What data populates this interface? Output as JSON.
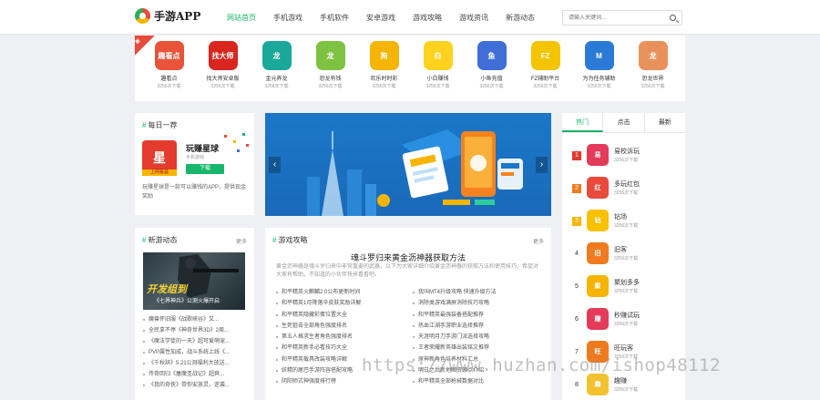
{
  "header": {
    "logo_text": "手游APP",
    "nav": [
      "网站首页",
      "手机游戏",
      "手机软件",
      "安卓游戏",
      "游戏攻略",
      "游戏资讯",
      "新游动态"
    ],
    "search_placeholder": "请输入关键词..."
  },
  "new_badge": "新",
  "apps": [
    {
      "name": "趣看点",
      "downloads": "3256次下载",
      "icon_text": "趣看点",
      "color": "#e8533a"
    },
    {
      "name": "找大师安卓版",
      "downloads": "3256次下载",
      "icon_text": "找大师",
      "color": "#d9251d"
    },
    {
      "name": "金元养龙",
      "downloads": "3256次下载",
      "icon_text": "龙",
      "color": "#1aa89a"
    },
    {
      "name": "恐龙有钱",
      "downloads": "3256次下载",
      "icon_text": "龙",
      "color": "#7dc241"
    },
    {
      "name": "欢乐时时彩",
      "downloads": "3256次下载",
      "icon_text": "狗",
      "color": "#f4b400"
    },
    {
      "name": "小白赚钱",
      "downloads": "3256次下载",
      "icon_text": "白",
      "color": "#ffd21f"
    },
    {
      "name": "小鱼充值",
      "downloads": "3256次下载",
      "icon_text": "鱼",
      "color": "#3f6fd6"
    },
    {
      "name": "FZ辅助平台",
      "downloads": "3256次下载",
      "icon_text": "FZ",
      "color": "#f5c400"
    },
    {
      "name": "为为任务辅助",
      "downloads": "3256次下载",
      "icon_text": "M",
      "color": "#2b7bd6"
    },
    {
      "name": "恐龙世界",
      "downloads": "3256次下载",
      "icon_text": "龙",
      "color": "#e9915b"
    }
  ],
  "daily": {
    "title": "每日一荐",
    "app_name": "玩赚星球",
    "app_icon_text": "星",
    "app_tag": "上网看益",
    "category": "手机游戏",
    "download_label": "下载",
    "description": "玩赚星球是一款可以赚钱的APP，提供现金奖励"
  },
  "hot": {
    "tabs": [
      "热门",
      "点击",
      "最新"
    ],
    "items": [
      {
        "rank": "1",
        "name": "易校诉玩",
        "downloads": "3256次下载",
        "icon_text": "易",
        "color": "#e33b59"
      },
      {
        "name": "多玩红包",
        "rank": "2",
        "downloads": "3256次下载",
        "icon_text": "红",
        "color": "#e84a3c"
      },
      {
        "name": "钻场",
        "rank": "3",
        "downloads": "3256次下载",
        "icon_text": "钻",
        "color": "#f7c100"
      },
      {
        "name": "旧客",
        "rank": "4",
        "downloads": "3256次下载",
        "icon_text": "旧",
        "color": "#f07a1f"
      },
      {
        "name": "聚划多多",
        "rank": "5",
        "downloads": "3256次下载",
        "icon_text": "聚",
        "color": "#f4b400"
      },
      {
        "name": "秒赚试玩",
        "rank": "6",
        "downloads": "3256次下载",
        "icon_text": "赚",
        "color": "#e33b59"
      },
      {
        "name": "旺玩客",
        "rank": "7",
        "downloads": "3256次下载",
        "icon_text": "旺",
        "color": "#f07a1f"
      },
      {
        "name": "趣赚",
        "rank": "8",
        "downloads": "3256次下载",
        "icon_text": "趣",
        "color": "#f2c230"
      }
    ]
  },
  "newgame": {
    "title": "新游动态",
    "more": "更多",
    "img_text1": "开发组到",
    "img_text2": "《七界神兵》公测火爆开启",
    "items": [
      "魔兽怀旧服《战歌峡谷》又...",
      "全民拿不停《神奇世界3D》2周...",
      "《魔法学徒的一天》超可爱萌宠...",
      "PVP属性加成，战斗系统上线《...",
      "《千秋辞》5.21公测福利大放送...",
      "传奇回归《屠魔圣战记》超爽...",
      "《我的奇侠》带你安放灵，逆袭..."
    ]
  },
  "strategy": {
    "title": "游戏攻略",
    "more": "更多",
    "headline": "魂斗罗归来黄金沥神器获取方法",
    "summary": "黄金沥神器是魂斗罗归来中非常重要的武器，以下为大家详细介绍黄金沥神器的获取方法和使用技巧，希望对大家有帮助。不知道的小伙伴快来看看吧。",
    "items": [
      "和平精英火麒麟2.0公布更新时间",
      "我叫MT4升级攻略 快速升级方法",
      "和平精英1月降落伞皮肤奖励详解",
      "消除类游戏满屏消除技巧攻略",
      "和平精英隐藏彩蛋位置大全",
      "和平精英最强装备搭配推荐",
      "生死狙击全部角色强度排名",
      "热血江湖手游职业选择推荐",
      "第五人格求生者角色强度排名",
      "天涯明月刀手游门派选择攻略",
      "和平精英新手必看技巧大全",
      "王者荣耀新英雄出装铭文推荐",
      "和平精英载具改装攻略详解",
      "原神新角色培养材料汇总",
      "妖精的尾巴手游阵容搭配攻略",
      "明日之后新地图资源点介绍",
      "阴阳师式神强度排行榜",
      "和平精英全部枪械数据对比"
    ]
  },
  "watermark": "https://www.huzhan.com/ishop48112"
}
